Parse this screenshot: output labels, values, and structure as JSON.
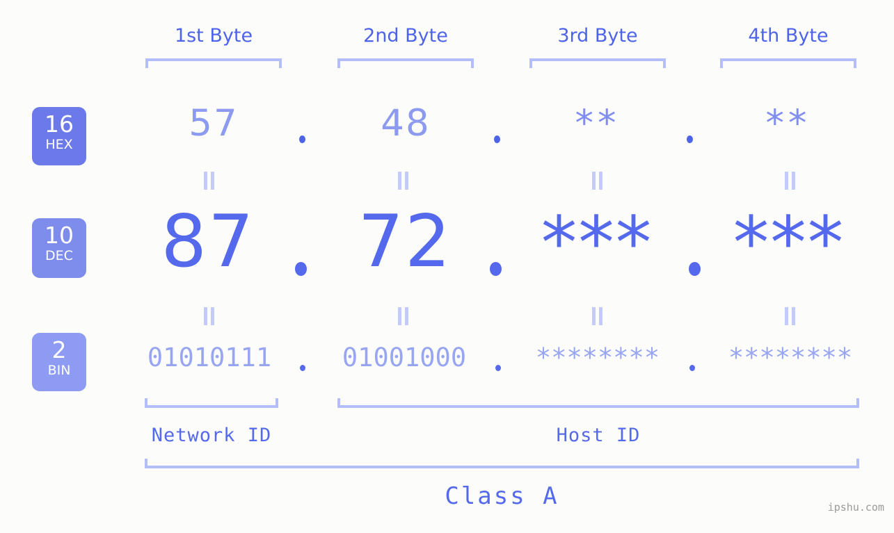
{
  "background_color": "#fcfdfa",
  "accent_colors": {
    "strong_blue": "#5569ec",
    "mid_blue": "#8c9bf0",
    "light_blue": "#b3bdfa",
    "badge_hex": "#6b7ae8",
    "badge_dec": "#7e8cec",
    "badge_bin": "#8d9cf2",
    "watermark_gray": "#9a9a9a"
  },
  "byte_headers": [
    {
      "label": "1st Byte"
    },
    {
      "label": "2nd Byte"
    },
    {
      "label": "3rd Byte"
    },
    {
      "label": "4th Byte"
    }
  ],
  "bases": [
    {
      "number": "16",
      "abbr": "HEX"
    },
    {
      "number": "10",
      "abbr": "DEC"
    },
    {
      "number": "2",
      "abbr": "BIN"
    }
  ],
  "rows": {
    "hex": {
      "base_number": "16",
      "base_abbr": "HEX",
      "values": [
        "57",
        "48",
        "**",
        "**"
      ],
      "separator": "."
    },
    "dec": {
      "base_number": "10",
      "base_abbr": "DEC",
      "values": [
        "87",
        "72",
        "***",
        "***"
      ],
      "separator": "."
    },
    "bin": {
      "base_number": "2",
      "base_abbr": "BIN",
      "values": [
        "01010111",
        "01001000",
        "********",
        "********"
      ],
      "separator": "."
    }
  },
  "equality_marker": "||",
  "segments": {
    "network_id": "Network ID",
    "host_id": "Host ID",
    "class": "Class A"
  },
  "watermark": "ipshu.com",
  "chart_data": {
    "type": "table",
    "title": "IP address byte breakdown",
    "categories": [
      "1st Byte",
      "2nd Byte",
      "3rd Byte",
      "4th Byte"
    ],
    "series": [
      {
        "name": "HEX",
        "values": [
          "57",
          "48",
          "**",
          "**"
        ]
      },
      {
        "name": "DEC",
        "values": [
          "87",
          "72",
          "***",
          "***"
        ]
      },
      {
        "name": "BIN",
        "values": [
          "01010111",
          "01001000",
          "********",
          "********"
        ]
      }
    ],
    "annotations": [
      "Network ID",
      "Host ID",
      "Class A"
    ]
  }
}
